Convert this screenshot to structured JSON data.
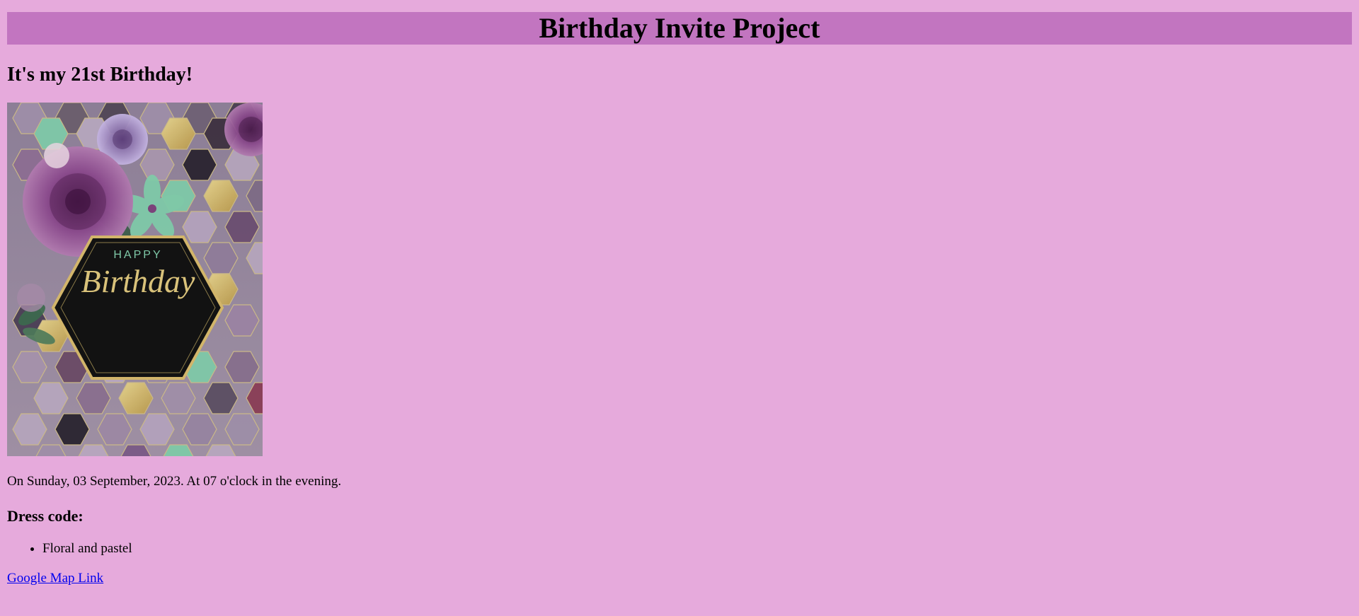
{
  "header": {
    "title": "Birthday Invite Project"
  },
  "main": {
    "subtitle": "It's my 21st Birthday!",
    "card": {
      "icon": "birthday-card-image",
      "line1": "HAPPY",
      "line2": "Birthday",
      "colors": {
        "accent_gold": "#d9c27a",
        "mint": "#7fc9a8",
        "dark": "#121212",
        "purple": "#7a3f79"
      }
    },
    "when": "On Sunday, 03 September, 2023. At 07 o'clock in the evening.",
    "dress_code": {
      "title": "Dress code:",
      "items": [
        "Floral and pastel"
      ]
    },
    "map_link": {
      "label": "Google Map Link"
    }
  }
}
